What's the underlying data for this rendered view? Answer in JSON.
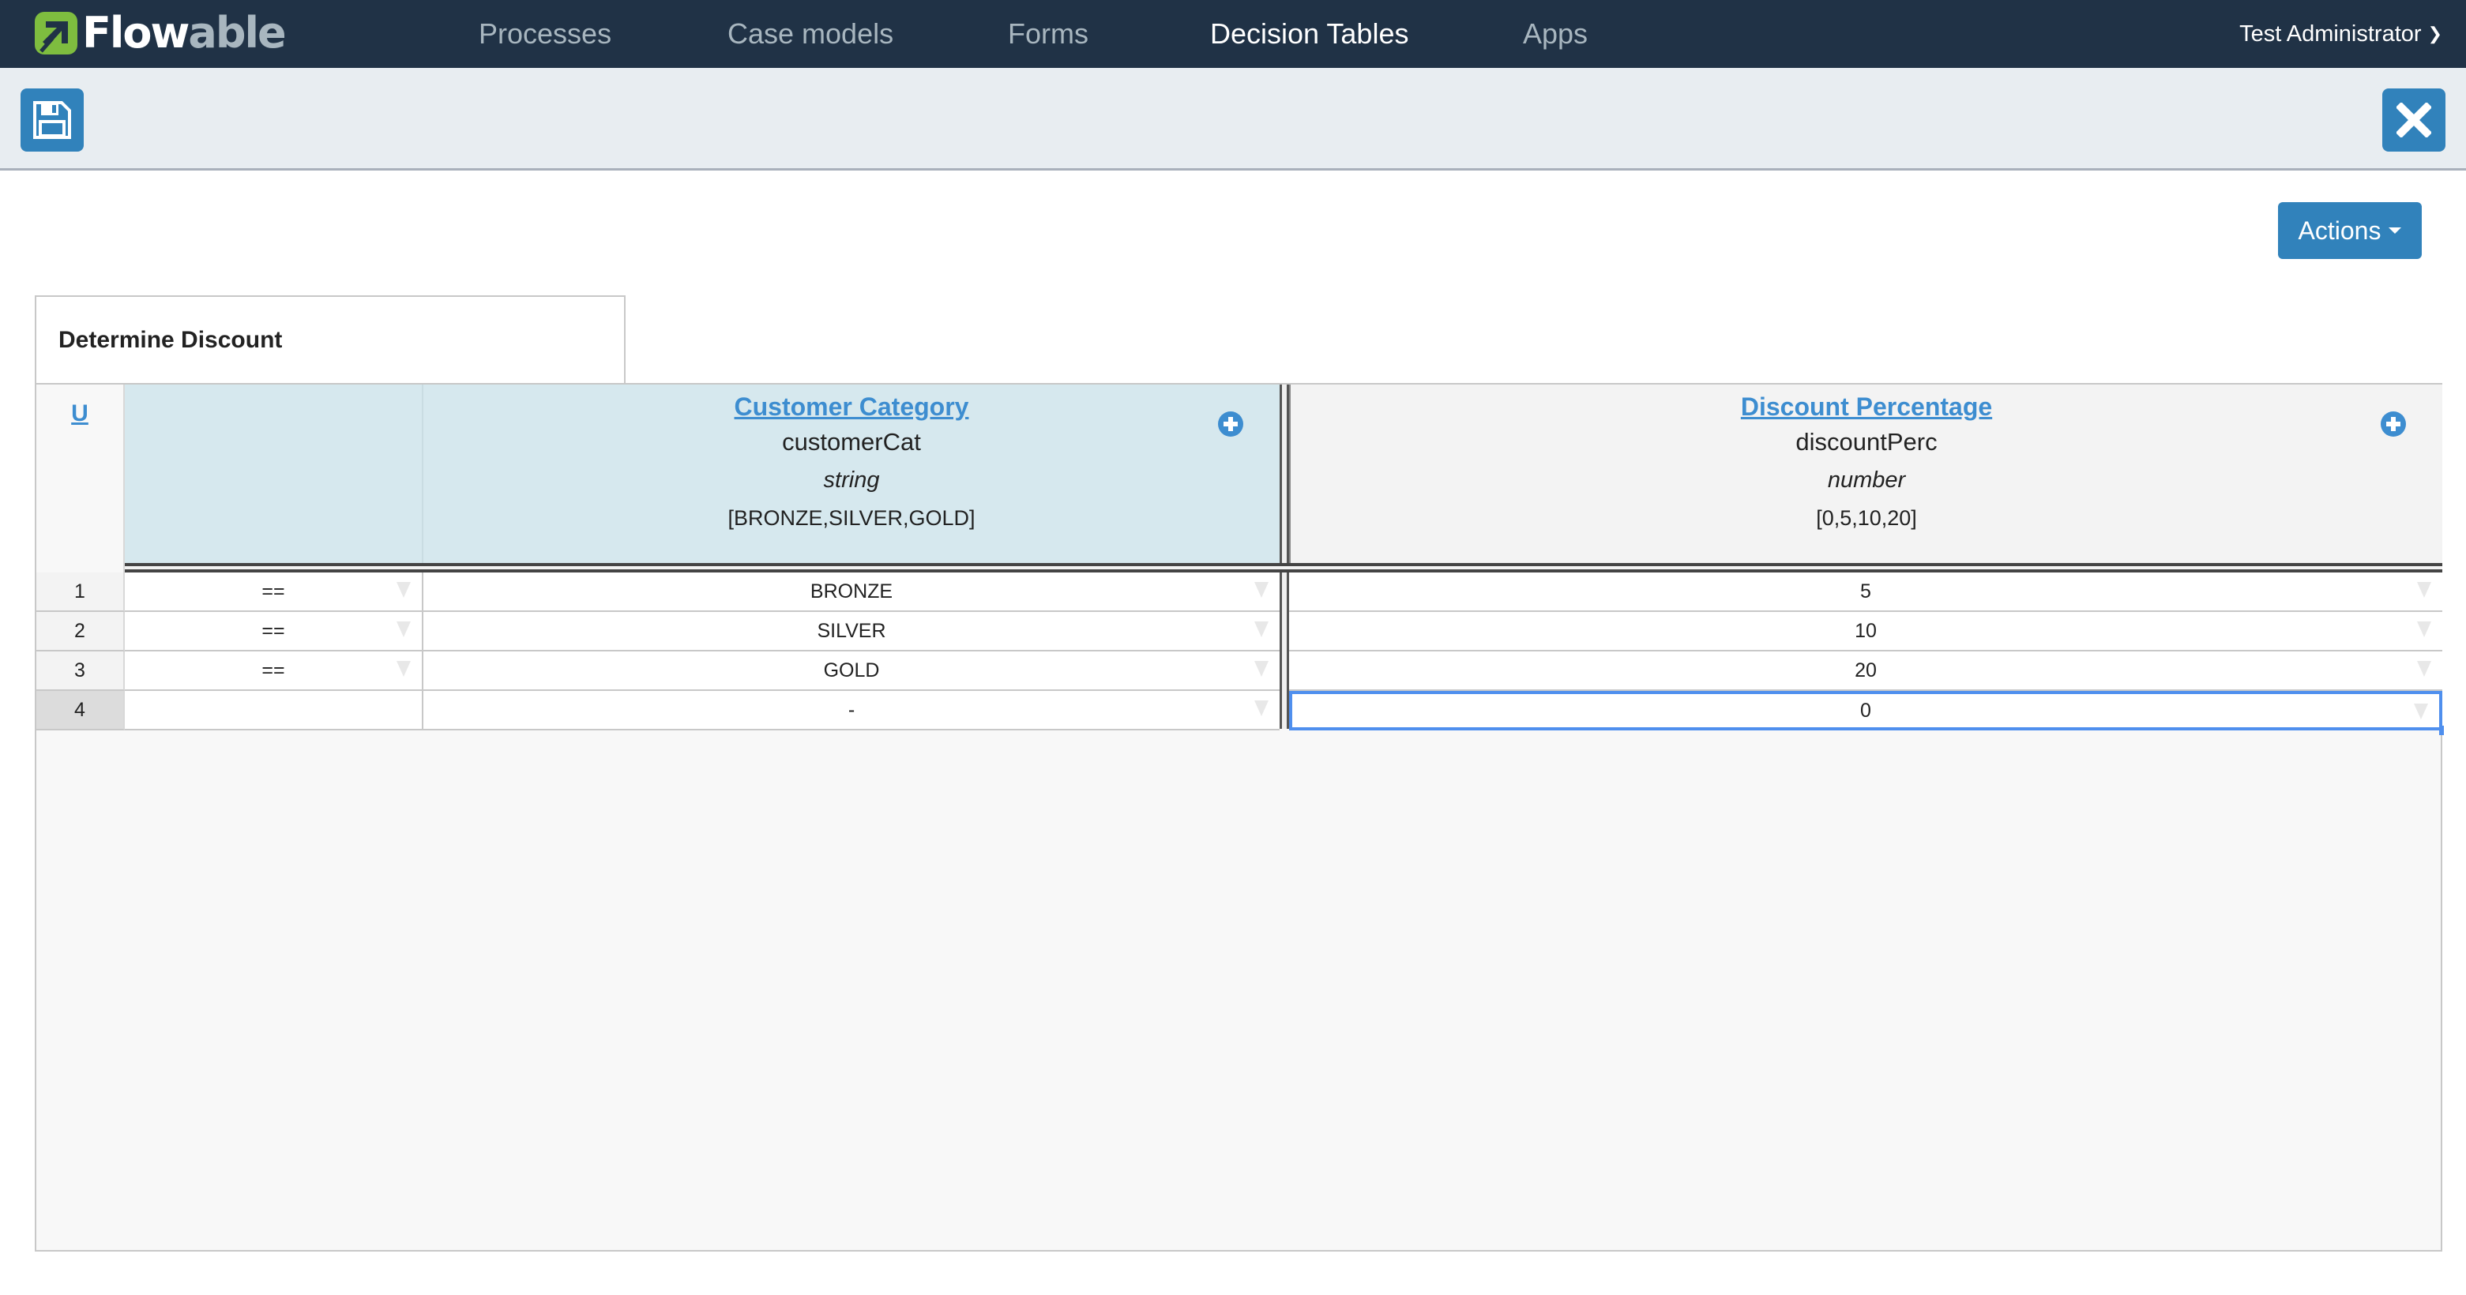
{
  "nav": {
    "logo": {
      "part1": "Flow",
      "part2": "able"
    },
    "items": [
      {
        "label": "Processes",
        "active": false
      },
      {
        "label": "Case models",
        "active": false
      },
      {
        "label": "Forms",
        "active": false
      },
      {
        "label": "Decision Tables",
        "active": true
      },
      {
        "label": "Apps",
        "active": false
      }
    ],
    "user": "Test Administrator",
    "user_icon": "chevron-down-icon"
  },
  "toolbar": {
    "save_icon": "floppy-disk-icon",
    "close_icon": "close-icon"
  },
  "actions": {
    "label": "Actions"
  },
  "decision_table": {
    "title": "Determine Discount",
    "hit_policy": "U",
    "input": {
      "label": "Customer Category",
      "variable": "customerCat",
      "type": "string",
      "values": "[BRONZE,SILVER,GOLD]"
    },
    "output": {
      "label": "Discount Percentage",
      "variable": "discountPerc",
      "type": "number",
      "values": "[0,5,10,20]"
    },
    "rows": [
      {
        "num": "1",
        "operator": "==",
        "input": "BRONZE",
        "output": "5"
      },
      {
        "num": "2",
        "operator": "==",
        "input": "SILVER",
        "output": "10"
      },
      {
        "num": "3",
        "operator": "==",
        "input": "GOLD",
        "output": "20"
      },
      {
        "num": "4",
        "operator": "",
        "input": "-",
        "output": "0"
      }
    ],
    "selected_row": 4,
    "colors": {
      "accent": "#3182bb",
      "link": "#3d8dd0",
      "selection": "#4f8fee",
      "input_header": "#d6e8ee",
      "nav_bg": "#203246"
    }
  }
}
